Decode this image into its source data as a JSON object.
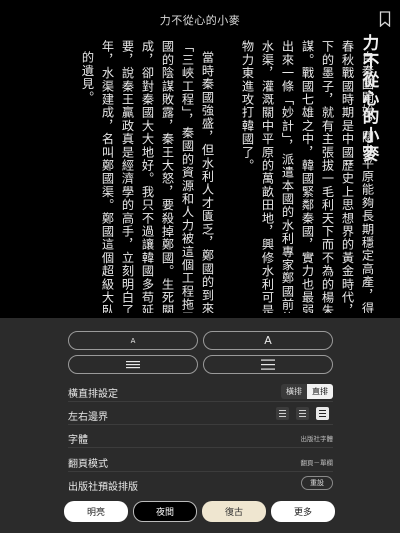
{
  "header": {
    "book_title": "力不從心的小麥"
  },
  "reader": {
    "chapter_title": "力不從心的小麥",
    "columns": [
      "自秦國開始，關中平原能夠長期穩定高產，得益於古代著",
      "春秋戰國時期是中國歷史上思想界的黃金時代，當時出",
      "下的墨子，就有主張拔一毛利天下而不為的楊朱。鄭國渠這個",
      "謀。戰國七雄之中，韓國緊鄰秦國，實力也最弱，隨時有被強",
      "出來一條「妙計」，派遣本國的水利專家鄭國前往秦國，鼓動",
      "水渠，灌溉關中平原的萬畝田地，興修水利可是大工程，此計",
      "物力東進攻打韓國了。",
      "",
      "當時秦國強盛，但水利人才匱乏，鄭國的到來讓秦王喜出",
      "「三峽工程」，秦國的資源和人力被這個工程拖了十幾年。",
      "國的陰謀敗露，秦王大怒，要殺掉鄭國。生死關頭，鄭國對秦",
      "成，卻對秦國大大地好。我只不過讓韓國多苟延殘喘了幾年，",
      "要，說秦王贏政真是經濟學的高手，立刻明白了這個道理。",
      "年，水渠建成，名叫鄭國渠。鄭國這個超級大臥底夠名垂千",
      "的遺見。"
    ]
  },
  "panel": {
    "font_small_label": "A",
    "font_large_label": "A",
    "line_spacing_tight_label": "",
    "line_spacing_loose_label": "",
    "orientation": {
      "label": "橫直排設定",
      "options": [
        "橫排",
        "直排"
      ],
      "selected": "直排"
    },
    "margins": {
      "label": "左右邊界",
      "selected_index": 2
    },
    "font": {
      "label": "字體",
      "value": "出版社字體"
    },
    "page_mode": {
      "label": "翻頁模式",
      "value": "翻頁－單欄"
    },
    "publisher_layout": {
      "label": "出版社預設排版",
      "reset_label": "重設"
    },
    "themes": [
      {
        "label": "明亮"
      },
      {
        "label": "夜間"
      },
      {
        "label": "復古"
      },
      {
        "label": "更多"
      }
    ]
  }
}
